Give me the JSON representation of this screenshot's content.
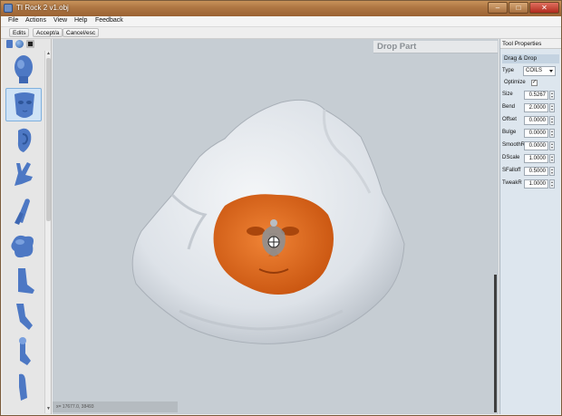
{
  "window": {
    "title": "TI Rock 2 v1.obj"
  },
  "menu": [
    "File",
    "Actions",
    "View",
    "Help",
    "Feedback"
  ],
  "toolbar": {
    "edits": "Edits",
    "accept": "Accept/a",
    "cancel": "Cancel/esc"
  },
  "viewport": {
    "title": "Drop Part",
    "status": "x= 17677.0, 38493"
  },
  "library": [
    "head",
    "face",
    "ear",
    "hand",
    "finger",
    "blob",
    "foot",
    "leg",
    "toe",
    "arm"
  ],
  "tool_properties": {
    "header": "Tool Properties",
    "section": "Drag & Drop",
    "type_label": "Type",
    "type_value": "COILS",
    "optimize_label": "Optimize",
    "optimize_checked": "✓",
    "params": [
      {
        "label": "Size",
        "value": "0.5267"
      },
      {
        "label": "Bend",
        "value": "2.0000"
      },
      {
        "label": "Offset",
        "value": "0.0000"
      },
      {
        "label": "Bulge",
        "value": "0.0000"
      },
      {
        "label": "SmoothR",
        "value": "0.0000"
      },
      {
        "label": "DScale",
        "value": "1.0000"
      },
      {
        "label": "SFalloff",
        "value": "0.5000"
      },
      {
        "label": "TweakR",
        "value": "1.0000"
      }
    ]
  },
  "colors": {
    "accent_orange": "#e0661c",
    "mesh_gray": "#e9ecf0",
    "part_blue": "#4d78c4"
  }
}
